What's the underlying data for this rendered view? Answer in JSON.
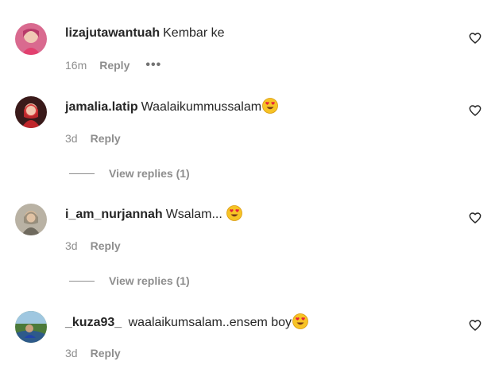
{
  "comments": [
    {
      "username": "lizajutawantuah",
      "text": "Kembar ke",
      "emoji": "",
      "time": "16m",
      "reply_label": "Reply",
      "more_label": "•••",
      "view_replies": ""
    },
    {
      "username": "jamalia.latip",
      "text": "Waalaikummussalam",
      "emoji": "heart-eyes-emoji",
      "time": "3d",
      "reply_label": "Reply",
      "more_label": "",
      "view_replies": "View replies (1)"
    },
    {
      "username": "i_am_nurjannah",
      "text": "Wsalam... ",
      "emoji": "heart-eyes-emoji",
      "time": "3d",
      "reply_label": "Reply",
      "more_label": "",
      "view_replies": "View replies (1)"
    },
    {
      "username": "_kuza93_",
      "text": " waalaikumsalam..ensem boy",
      "emoji": "heart-eyes-emoji",
      "time": "3d",
      "reply_label": "Reply",
      "more_label": "",
      "view_replies": ""
    }
  ],
  "icons": {
    "like": "heart-outline-icon",
    "emoji": "smiling-face-with-heart-eyes"
  },
  "colors": {
    "text_primary": "#262626",
    "text_secondary": "#8e8e8e"
  }
}
